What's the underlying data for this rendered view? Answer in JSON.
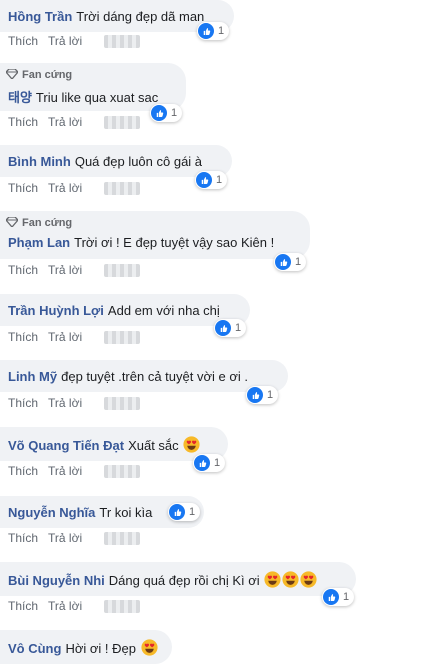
{
  "reactions": {
    "like_count_label": "1"
  },
  "actions": {
    "like": "Thích",
    "reply": "Trả lời"
  },
  "badge": {
    "fan_label": "Fan cứng"
  },
  "comments": [
    {
      "name": "Hồng Trần",
      "text": "Trời dáng đẹp dã man"
    },
    {
      "name": "태양",
      "text": "Triu like qua xuat sac"
    },
    {
      "name": "Bình Minh",
      "text": "Quá đẹp luôn cô gái à"
    },
    {
      "name": "Phạm Lan",
      "text": "Trời ơi ! E đẹp tuyệt vậy sao Kiên !"
    },
    {
      "name": "Trần Huỳnh Lợi",
      "text": "Add em với nha chị"
    },
    {
      "name": "Linh Mỹ",
      "text": "đẹp tuyệt .trên cả tuyệt vời e ơi ."
    },
    {
      "name": "Võ Quang Tiến Đạt",
      "text": "Xuất sắc"
    },
    {
      "name": "Nguyễn Nghĩa",
      "text": "Tr koi kìa"
    },
    {
      "name": "Bùi Nguyễn Nhi",
      "text": "Dáng quá đẹp rồi chị Kì ơi"
    },
    {
      "name": "Vô Cùng",
      "text": "Hời ơi ! Đẹp"
    }
  ],
  "emoji_icons": [
    "heart-eyes-emoji-icon"
  ],
  "colors": {
    "name": "#385898",
    "bubble": "#f0f2f5",
    "like": "#1877f2"
  }
}
